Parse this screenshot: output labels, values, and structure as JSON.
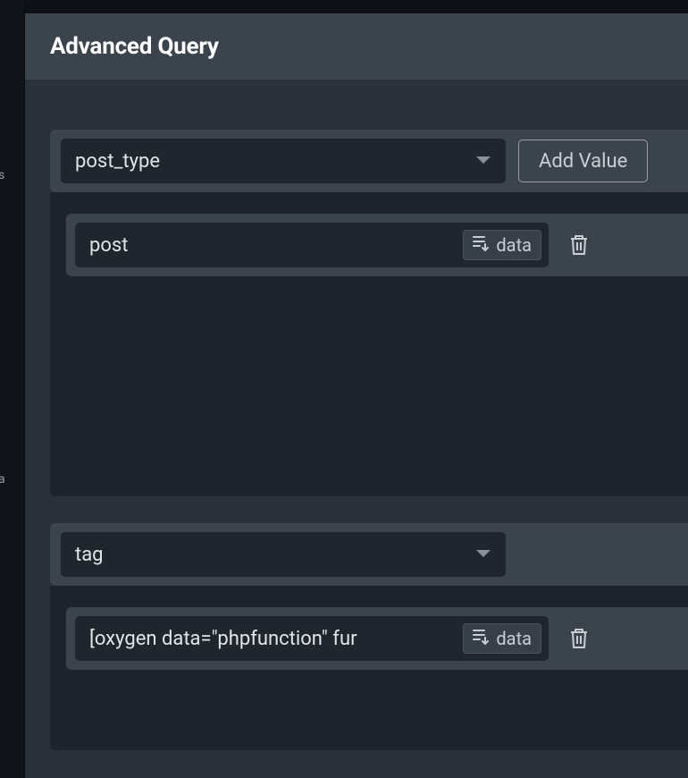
{
  "modal": {
    "title": "Advanced Query"
  },
  "blocks": [
    {
      "param": "post_type",
      "add_label": "Add Value",
      "values": [
        {
          "text": "post",
          "data_label": "data"
        }
      ]
    },
    {
      "param": "tag",
      "values": [
        {
          "text": "[oxygen data=\"phpfunction\" fur",
          "data_label": "data"
        }
      ]
    }
  ],
  "bg_fragments": {
    "a": "s",
    "b": "a"
  }
}
